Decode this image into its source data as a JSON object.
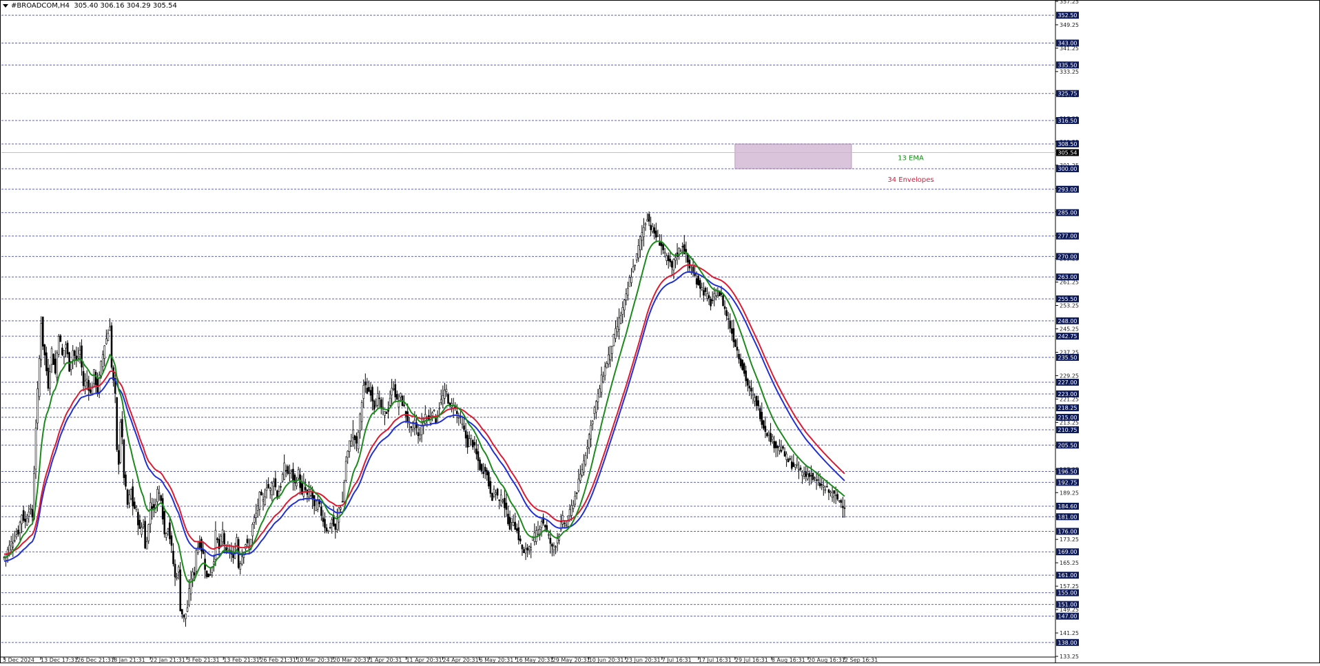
{
  "header": {
    "symbol": "#BROADCOM,H4",
    "ohlc": "305.40 306.16 304.29 305.54"
  },
  "chart_data": {
    "type": "candlestick",
    "symbol": "#BROADCOM",
    "timeframe": "H4",
    "current_price": 305.54,
    "ylim": [
      133.25,
      357.25
    ],
    "y_ticks": [
      "357.25",
      "349.25",
      "341.25",
      "333.25",
      "325.25",
      "317.25",
      "309.25",
      "301.25",
      "293.25",
      "285.25",
      "277.25",
      "269.25",
      "261.25",
      "253.25",
      "245.25",
      "237.25",
      "229.25",
      "221.25",
      "213.25",
      "205.25",
      "197.25",
      "189.25",
      "181.25",
      "173.25",
      "165.25",
      "157.25",
      "149.25",
      "141.25",
      "133.25"
    ],
    "x_ticks": [
      "3 Dec 2024",
      "13 Dec 17:31",
      "26 Dec 21:31",
      "8 Jan 21:31",
      "22 Jan 21:31",
      "3 Feb 21:31",
      "13 Feb 21:31",
      "26 Feb 21:31",
      "10 Mar 20:31",
      "20 Mar 20:31",
      "1 Apr 20:31",
      "11 Apr 20:31",
      "24 Apr 20:31",
      "6 May 20:31",
      "16 May 20:31",
      "29 May 20:31",
      "10 Jun 20:31",
      "23 Jun 20:31",
      "7 Jul 16:31",
      "17 Jul 16:31",
      "29 Jul 16:31",
      "8 Aug 16:31",
      "20 Aug 16:31",
      "2 Sep 16:31"
    ],
    "levels": [
      352.5,
      343.0,
      335.5,
      325.75,
      316.5,
      308.5,
      300.0,
      293.0,
      285.0,
      277.0,
      270.0,
      263.0,
      255.5,
      248.0,
      242.75,
      235.5,
      227.0,
      223.0,
      218.25,
      215.0,
      210.75,
      205.5,
      196.5,
      192.75,
      184.6,
      181.0,
      176.0,
      169.0,
      161.0,
      155.0,
      151.0,
      147.0,
      138.0
    ],
    "level_labels": [
      "352.50",
      "343.00",
      "335.50",
      "325.75",
      "316.50",
      "308.50",
      "300.00",
      "293.00",
      "285.00",
      "277.00",
      "270.00",
      "263.00",
      "255.50",
      "248.00",
      "242.75",
      "235.50",
      "227.00",
      "223.00",
      "218.25",
      "215.00",
      "210.75",
      "205.50",
      "196.50",
      "192.75",
      "184.60",
      "181.00",
      "176.00",
      "169.00",
      "161.00",
      "155.00",
      "151.00",
      "147.00",
      "138.00"
    ],
    "zone": {
      "from": 300.0,
      "to": 308.5,
      "start": "29 Jul 16:31"
    },
    "annotations": [
      {
        "text": "13 EMA",
        "color": "#1a8a1a"
      },
      {
        "text": "34 Envelopes",
        "color": "#d61a3c"
      }
    ],
    "close_path": [
      [
        0,
        167
      ],
      [
        4,
        172
      ],
      [
        8,
        176
      ],
      [
        10,
        182
      ],
      [
        12,
        179
      ],
      [
        14,
        184
      ],
      [
        16,
        181
      ],
      [
        18,
        212
      ],
      [
        20,
        235
      ],
      [
        21,
        248
      ],
      [
        22,
        240
      ],
      [
        23,
        236
      ],
      [
        25,
        226
      ],
      [
        27,
        238
      ],
      [
        29,
        230
      ],
      [
        31,
        244
      ],
      [
        33,
        236
      ],
      [
        35,
        240
      ],
      [
        37,
        232
      ],
      [
        39,
        238
      ],
      [
        41,
        234
      ],
      [
        43,
        238
      ],
      [
        45,
        226
      ],
      [
        47,
        228
      ],
      [
        49,
        223
      ],
      [
        51,
        230
      ],
      [
        53,
        224
      ],
      [
        55,
        233
      ],
      [
        57,
        240
      ],
      [
        59,
        244
      ],
      [
        60,
        247
      ],
      [
        61,
        232
      ],
      [
        63,
        222
      ],
      [
        64,
        203
      ],
      [
        65,
        200
      ],
      [
        66,
        214
      ],
      [
        67,
        207
      ],
      [
        68,
        195
      ],
      [
        70,
        185
      ],
      [
        72,
        190
      ],
      [
        73,
        185
      ],
      [
        75,
        183
      ],
      [
        77,
        176
      ],
      [
        79,
        179
      ],
      [
        80,
        170
      ],
      [
        82,
        178
      ],
      [
        83,
        186
      ],
      [
        85,
        183
      ],
      [
        87,
        190
      ],
      [
        89,
        188
      ],
      [
        91,
        175
      ],
      [
        93,
        178
      ],
      [
        95,
        170
      ],
      [
        97,
        160
      ],
      [
        99,
        163
      ],
      [
        100,
        150
      ],
      [
        102,
        146
      ],
      [
        104,
        150
      ],
      [
        106,
        160
      ],
      [
        108,
        162
      ],
      [
        109,
        170
      ],
      [
        111,
        172
      ],
      [
        113,
        168
      ],
      [
        115,
        160
      ],
      [
        117,
        162
      ],
      [
        119,
        167
      ],
      [
        120,
        175
      ],
      [
        122,
        170
      ],
      [
        124,
        176
      ],
      [
        126,
        168
      ],
      [
        128,
        170
      ],
      [
        130,
        166
      ],
      [
        132,
        174
      ],
      [
        133,
        164
      ],
      [
        135,
        168
      ],
      [
        137,
        172
      ],
      [
        139,
        170
      ],
      [
        141,
        178
      ],
      [
        143,
        182
      ],
      [
        145,
        188
      ],
      [
        147,
        186
      ],
      [
        149,
        192
      ],
      [
        151,
        190
      ],
      [
        153,
        194
      ],
      [
        155,
        188
      ],
      [
        157,
        192
      ],
      [
        159,
        198
      ],
      [
        161,
        196
      ],
      [
        163,
        196
      ],
      [
        165,
        192
      ],
      [
        167,
        196
      ],
      [
        169,
        188
      ],
      [
        170,
        192
      ],
      [
        172,
        188
      ],
      [
        174,
        190
      ],
      [
        176,
        184
      ],
      [
        178,
        186
      ],
      [
        180,
        182
      ],
      [
        182,
        178
      ],
      [
        184,
        176
      ],
      [
        186,
        180
      ],
      [
        188,
        176
      ],
      [
        190,
        184
      ],
      [
        192,
        186
      ],
      [
        194,
        200
      ],
      [
        196,
        206
      ],
      [
        198,
        210
      ],
      [
        200,
        205
      ],
      [
        202,
        215
      ],
      [
        204,
        226
      ],
      [
        206,
        224
      ],
      [
        208,
        224
      ],
      [
        210,
        219
      ],
      [
        212,
        222
      ],
      [
        214,
        218
      ],
      [
        216,
        216
      ],
      [
        218,
        218
      ],
      [
        219,
        222
      ],
      [
        221,
        226
      ],
      [
        223,
        220
      ],
      [
        225,
        222
      ],
      [
        227,
        218
      ],
      [
        229,
        214
      ],
      [
        231,
        210
      ],
      [
        233,
        214
      ],
      [
        235,
        208
      ],
      [
        237,
        212
      ],
      [
        239,
        216
      ],
      [
        241,
        214
      ],
      [
        243,
        218
      ],
      [
        245,
        214
      ],
      [
        247,
        219
      ],
      [
        249,
        222
      ],
      [
        251,
        224
      ],
      [
        253,
        218
      ],
      [
        255,
        220
      ],
      [
        257,
        216
      ],
      [
        259,
        214
      ],
      [
        261,
        210
      ],
      [
        263,
        206
      ],
      [
        265,
        208
      ],
      [
        267,
        204
      ],
      [
        269,
        200
      ],
      [
        271,
        196
      ],
      [
        273,
        198
      ],
      [
        275,
        192
      ],
      [
        277,
        188
      ],
      [
        279,
        190
      ],
      [
        281,
        186
      ],
      [
        283,
        188
      ],
      [
        285,
        182
      ],
      [
        287,
        178
      ],
      [
        289,
        180
      ],
      [
        291,
        176
      ],
      [
        293,
        172
      ],
      [
        295,
        168
      ],
      [
        297,
        170
      ],
      [
        299,
        172
      ],
      [
        301,
        174
      ],
      [
        303,
        176
      ],
      [
        305,
        180
      ],
      [
        307,
        178
      ],
      [
        309,
        174
      ],
      [
        311,
        170
      ],
      [
        313,
        172
      ],
      [
        315,
        176
      ],
      [
        317,
        180
      ],
      [
        319,
        178
      ],
      [
        321,
        182
      ],
      [
        323,
        186
      ],
      [
        325,
        190
      ],
      [
        327,
        195
      ],
      [
        329,
        200
      ],
      [
        331,
        206
      ],
      [
        333,
        212
      ],
      [
        335,
        218
      ],
      [
        337,
        222
      ],
      [
        339,
        228
      ],
      [
        341,
        232
      ],
      [
        343,
        236
      ],
      [
        345,
        240
      ],
      [
        347,
        244
      ],
      [
        349,
        248
      ],
      [
        351,
        252
      ],
      [
        353,
        256
      ],
      [
        355,
        262
      ],
      [
        357,
        266
      ],
      [
        359,
        270
      ],
      [
        361,
        276
      ],
      [
        363,
        280
      ],
      [
        365,
        284
      ],
      [
        367,
        280
      ],
      [
        369,
        278
      ],
      [
        371,
        276
      ],
      [
        373,
        274
      ],
      [
        375,
        270
      ],
      [
        377,
        268
      ],
      [
        379,
        266
      ],
      [
        381,
        270
      ],
      [
        383,
        272
      ],
      [
        385,
        274
      ],
      [
        387,
        270
      ],
      [
        389,
        266
      ],
      [
        391,
        264
      ],
      [
        393,
        262
      ],
      [
        395,
        260
      ],
      [
        397,
        258
      ],
      [
        399,
        256
      ],
      [
        401,
        254
      ],
      [
        403,
        256
      ],
      [
        405,
        258
      ],
      [
        407,
        256
      ],
      [
        409,
        252
      ],
      [
        411,
        248
      ],
      [
        413,
        244
      ],
      [
        415,
        240
      ],
      [
        417,
        236
      ],
      [
        419,
        232
      ],
      [
        421,
        228
      ],
      [
        423,
        224
      ],
      [
        425,
        222
      ],
      [
        427,
        220
      ],
      [
        429,
        216
      ],
      [
        431,
        212
      ],
      [
        433,
        210
      ],
      [
        435,
        208
      ],
      [
        437,
        206
      ],
      [
        439,
        205
      ],
      [
        441,
        204
      ],
      [
        443,
        202
      ],
      [
        445,
        200
      ],
      [
        447,
        199
      ],
      [
        449,
        198
      ],
      [
        451,
        197
      ],
      [
        453,
        196
      ],
      [
        455,
        195
      ],
      [
        457,
        196
      ],
      [
        459,
        194
      ],
      [
        461,
        193
      ],
      [
        463,
        192
      ],
      [
        465,
        191
      ],
      [
        467,
        190
      ],
      [
        469,
        189
      ],
      [
        471,
        188
      ],
      [
        473,
        187
      ],
      [
        475,
        186
      ],
      [
        477,
        185
      ]
    ]
  }
}
